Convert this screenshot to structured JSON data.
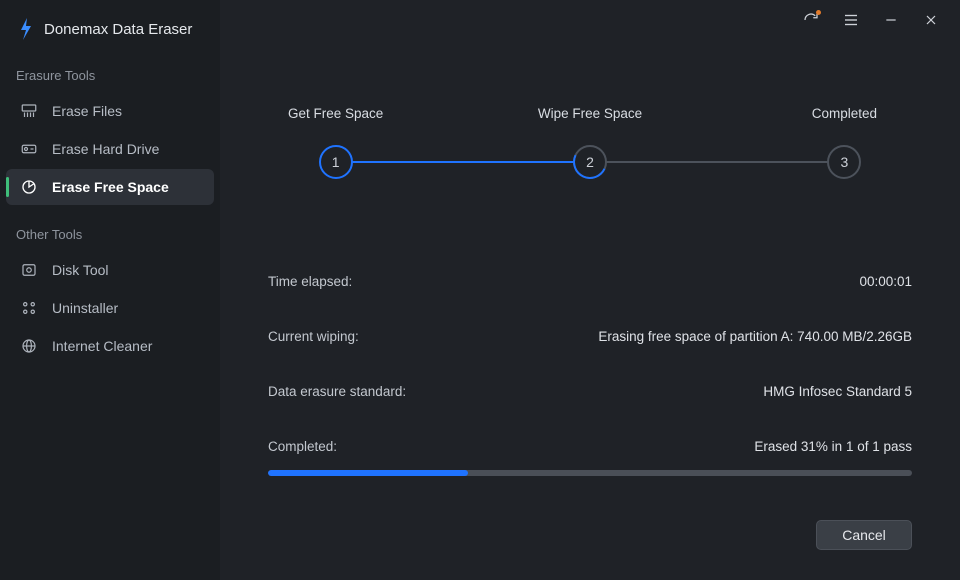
{
  "progress_percent": 31,
  "app": {
    "title": "Donemax Data Eraser"
  },
  "sidebar": {
    "section_a": "Erasure Tools",
    "section_b": "Other Tools",
    "items_a": [
      {
        "label": "Erase Files"
      },
      {
        "label": "Erase Hard Drive"
      },
      {
        "label": "Erase Free Space"
      }
    ],
    "items_b": [
      {
        "label": "Disk Tool"
      },
      {
        "label": "Uninstaller"
      },
      {
        "label": "Internet Cleaner"
      }
    ]
  },
  "stepper": {
    "s1": {
      "label": "Get Free Space",
      "num": "1"
    },
    "s2": {
      "label": "Wipe Free Space",
      "num": "2"
    },
    "s3": {
      "label": "Completed",
      "num": "3"
    }
  },
  "info": {
    "time_elapsed_label": "Time elapsed:",
    "time_elapsed_value": "00:00:01",
    "current_label": "Current wiping:",
    "current_value": "Erasing free space of partition A: 740.00 MB/2.26GB",
    "standard_label": "Data erasure standard:",
    "standard_value": "HMG Infosec Standard 5",
    "completed_label": "Completed:",
    "completed_value": "Erased 31% in 1 of 1 pass"
  },
  "footer": {
    "cancel_label": "Cancel"
  }
}
